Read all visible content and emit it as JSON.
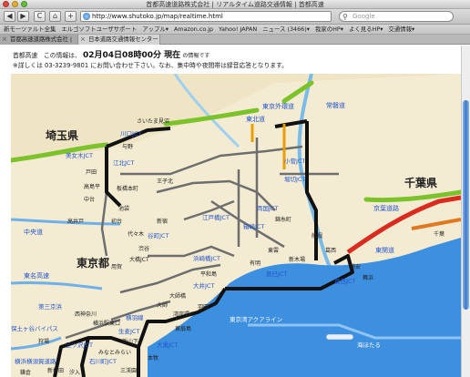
{
  "window": {
    "title": "首都高速道路株式会社 | リアルタイム道路交通情報 | 首都高速"
  },
  "toolbar": {
    "back_label": "◀",
    "forward_label": "▶",
    "reload_label": "C",
    "home_label": "⌂",
    "add_label": "+",
    "url": "http://www.shutoko.jp/map/realtime.html",
    "search_placeholder": "Google"
  },
  "bookmarks": [
    "新モーツァルト全集",
    "エルゴソフトユーザサポート",
    "アップル▾",
    "Amazon.co.jp",
    "Yahoo! JAPAN",
    "ニュース (3466)▾",
    "我家のHP▾",
    "よく見るHP▾",
    "交通情報▾"
  ],
  "tabs": [
    {
      "label": "首都高速道路株式会社 |"
    },
    {
      "label": "日本道路交通情報センター"
    }
  ],
  "info": {
    "prefix": "首都高速　この情報は、",
    "time": "02月04日08時00分 現在",
    "suffix": "の情報です",
    "note": "※詳しくは 03-3239-9801 にお問い合わせ下さい。なお、集中時や夜間帯は録音応答となります。"
  },
  "map": {
    "regions": {
      "saitama": "埼玉県",
      "tokyo": "東京都",
      "chiba": "千葉県"
    },
    "roads": {
      "tohoku": "東北道",
      "gaikan": "東京外環道",
      "joban": "常磐道",
      "chuo": "中央道",
      "tomei": "東名高速",
      "keiyo": "京葉道路",
      "higashi_kanto": "東関道",
      "aqualine": "東京湾アクアライン",
      "umihotaru": "海ほたる",
      "yokohane": "横羽線",
      "daisan_keihin": "第三京浜",
      "hodogaya": "保土ヶ谷バイパス",
      "yokohama_yokosuka": "横浜横須賀道路"
    },
    "junctions": [
      "川口JCT",
      "美女木JCT",
      "江北JCT",
      "小菅JCT",
      "堀切JCT",
      "両国JCT",
      "箱崎JCT",
      "江戸橋JCT",
      "谷町JCT",
      "浜崎橋JCT",
      "大井JCT",
      "辰巳JCT",
      "葛西JCT",
      "大黒JCT",
      "石川町JCT",
      "三ツ沢JCT",
      "生麦JCT"
    ],
    "places": [
      "さいたま見沼",
      "与野",
      "戸田",
      "高島平",
      "中台",
      "板橋本町",
      "王子北",
      "池袋",
      "新宿",
      "代々木",
      "初台",
      "渋谷",
      "用賀",
      "高井戸",
      "大橋JCT",
      "羽田",
      "湾岸環八",
      "浦安",
      "葛西",
      "船堀",
      "新木場",
      "有明",
      "東雲",
      "錦糸町",
      "平和島",
      "大師",
      "横浜駅東口",
      "みなとみらい",
      "本牧",
      "狩場",
      "新杉田",
      "三渓園",
      "大師橋",
      "東扇島",
      "舞浜",
      "千葉",
      "鎌倉",
      "汐入",
      "西神奈川",
      "新山下"
    ]
  },
  "colors": {
    "heavy": "#111111",
    "moderate": "#e8a000",
    "outside_green": "#7cc32b",
    "outside_red": "#d92b1e",
    "link_blue": "#2255cc",
    "sea": "#3d8fe0"
  }
}
